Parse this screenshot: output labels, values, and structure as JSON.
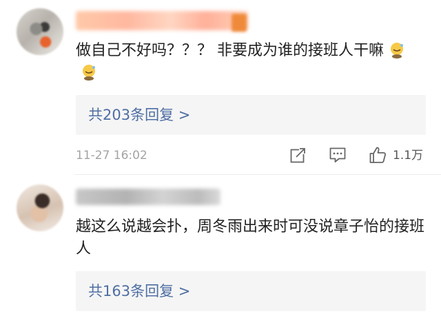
{
  "comments": [
    {
      "text": "做自己不好吗？？？ 非要成为谁的接班人干嘛",
      "emojis": [
        "sweat-smile-emoji",
        "sweat-smile-emoji"
      ],
      "replies_label": "共203条回复 >",
      "time": "11-27 16:02",
      "like_count": "1.1万"
    },
    {
      "text": "越这么说越会扑，周冬雨出来时可没说章子怡的接班人",
      "replies_label": "共163条回复 >"
    }
  ],
  "colors": {
    "link": "#4e6ea3",
    "meta": "#a3a3a3",
    "reply_bg": "#f5f5f5"
  },
  "icons": [
    "share-icon",
    "comment-icon",
    "like-icon"
  ]
}
